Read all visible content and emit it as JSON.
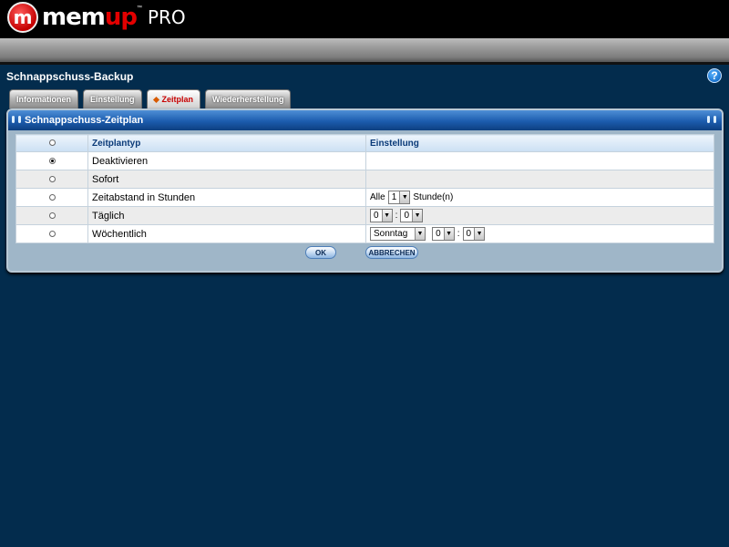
{
  "header": {
    "logo_badge": "m",
    "logo_mem": "mem",
    "logo_up": "up",
    "logo_pro": "PRO",
    "logo_tm": "™"
  },
  "page": {
    "title": "Schnappschuss-Backup",
    "help_label": "?"
  },
  "tabs": [
    {
      "label": "Informationen",
      "active": false
    },
    {
      "label": "Einstellung",
      "active": false
    },
    {
      "label": "Zeitplan",
      "active": true
    },
    {
      "label": "Wiederherstellung",
      "active": false
    }
  ],
  "panel": {
    "title": "Schnappschuss-Zeitplan",
    "columns": {
      "type": "Zeitplantyp",
      "setting": "Einstellung"
    },
    "rows": [
      {
        "label": "Deaktivieren",
        "selected": true
      },
      {
        "label": "Sofort",
        "selected": false
      },
      {
        "label": "Zeitabstand in Stunden",
        "selected": false,
        "prefix": "Alle",
        "interval_value": "1",
        "suffix": "Stunde(n)"
      },
      {
        "label": "Täglich",
        "selected": false,
        "hour": "0",
        "sep": ":",
        "minute": "0"
      },
      {
        "label": "Wöchentlich",
        "selected": false,
        "day": "Sonntag",
        "hour": "0",
        "sep": ":",
        "minute": "0"
      }
    ]
  },
  "buttons": {
    "ok": "OK",
    "cancel": "ABBRECHEN"
  },
  "colors": {
    "background": "#032c4d",
    "panel_header": "#1c5cae",
    "active_tab_text": "#c80000",
    "brand_red": "#e30000"
  }
}
